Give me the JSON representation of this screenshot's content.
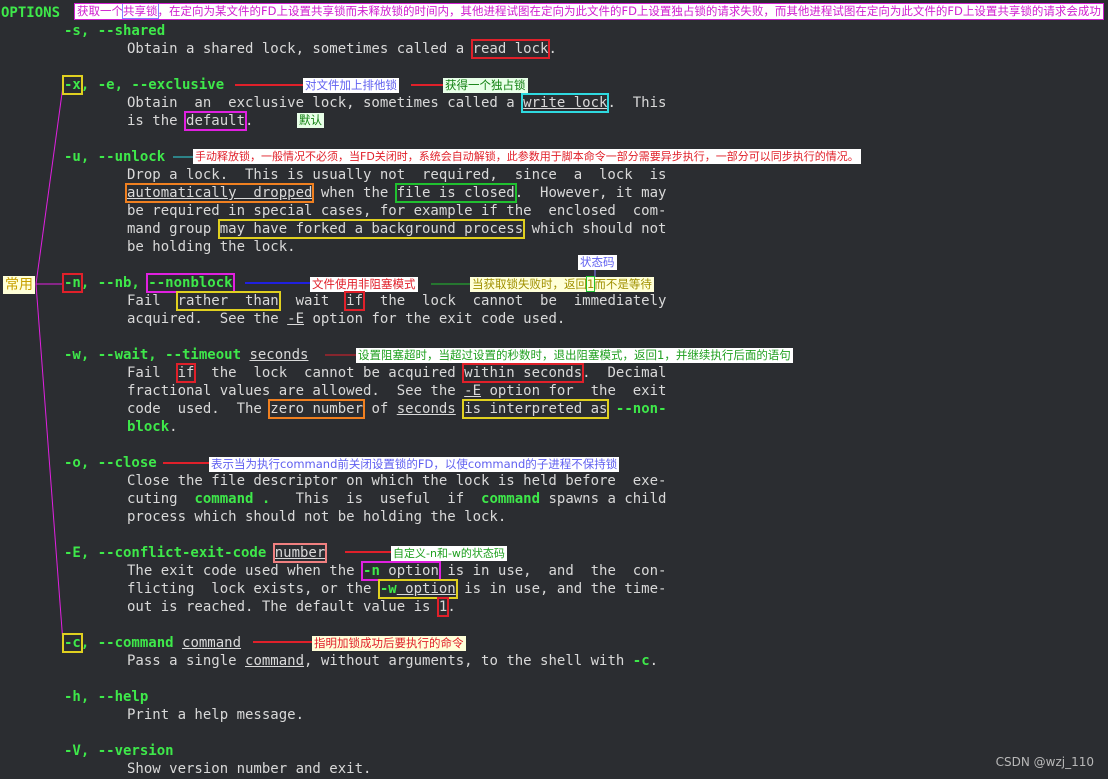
{
  "header": {
    "title": "OPTIONS",
    "note_pre": "获取一个",
    "note_box": "共享锁",
    "note_post": "，在定向为某文件的FD上设置共享锁而未释放锁的时间内，其他进程试图在定向为此文件的FD上设置独占锁的请求失败，而其他进程试图在定向为此文件的FD上设置共享锁的请求会成功"
  },
  "side_label": "常用",
  "s": {
    "flag": "-s, --shared",
    "d1a": "Obtain a shared lock, sometimes called a ",
    "d1b": "read lock",
    "d1c": "."
  },
  "x": {
    "f1": "-x",
    "f2": ", -e, --exclusive",
    "ann1": "对文件加上排他锁",
    "ann2": "获得一个独占锁",
    "d1a": "Obtain  an  exclusive lock, sometimes called a ",
    "d1b": "write lock",
    "d1c": ".  This",
    "d2a": "is the ",
    "d2b": "default",
    "d2c": ".",
    "ann3": "默认"
  },
  "u": {
    "flag": "-u, --unlock",
    "ann": "手动释放锁，一般情况不必须，当FD关闭时，系统会自动解锁，此参数用于脚本命令一部分需要异步执行，一部分可以同步执行的情况。",
    "d1": "Drop a lock.  This is usually not  required,  since  a  lock  is",
    "d2a": "automatically  dropped",
    "d2b": " when the ",
    "d2c": "file is closed",
    "d2d": ".  However, it may",
    "d3": "be required in special cases, for example if the  enclosed  com-",
    "d4a": "mand group ",
    "d4b": "may have forked a background process",
    "d4c": " which should not",
    "d5": "be holding the lock."
  },
  "n": {
    "f1": "-n",
    "f2": ", --nb, ",
    "f3": "--nonblock",
    "ann1": "文件使用非阻塞模式",
    "ann2a": "当获取锁失败时，返回",
    "ann2b": "1",
    "ann2c": "而不是等待",
    "ann_top": "状态码",
    "d1a": "Fail  ",
    "d1b": "rather  than",
    "d1c": "  wait  ",
    "d1d": "if",
    "d1e": "  the  lock  cannot  be  immediately",
    "d2a": "acquired.  See the ",
    "d2b": "-E",
    "d2c": " option for the exit code used."
  },
  "w": {
    "flag": "-w, --wait, --timeout ",
    "arg": "seconds",
    "ann": "设置阻塞超时，当超过设置的秒数时，退出阻塞模式，返回1，并继续执行后面的语句",
    "d1a": "Fail  ",
    "d1b": "if",
    "d1c": "  the  lock  cannot be acquired ",
    "d1d": "within seconds",
    ".": "",
    "d1e": ".  Decimal",
    "d2a": "fractional values are allowed.  See the ",
    "d2b": "-E",
    "d2c": " option for  the  exit",
    "d3a": "code  used.  The ",
    "d3b": "zero number",
    "d3c": " of ",
    "d3d": "seconds",
    "d3e": " ",
    "d3f": "is interpreted as",
    "d3g": " ",
    "d3h": "--non-",
    "d4": "block",
    "d4b": "."
  },
  "o": {
    "flag": "-o, --close",
    "ann": "表示当为执行command前关闭设置锁的FD，以使command的子进程不保持锁",
    "d1": "Close the file descriptor on which the lock is held before  exe-",
    "d2a": "cuting  ",
    "d2b": "command .",
    "d2c": "   This  is  useful  if  ",
    "d2d": "command",
    "d2e": " spawns a child",
    "d3": "process which should not be holding the lock."
  },
  "E": {
    "flag": "-E, --conflict-exit-code ",
    "arg": "number",
    "ann": "自定义-n和-w的状态码",
    "d1a": "The exit code used when the ",
    "d1b": "-n option",
    "d1c": " is in use,  and  the  con-",
    "d2a": "flicting  lock exists, or the ",
    "d2b": "-w option",
    "d2c": " is in use, and the time-",
    "d3a": "out is reached. The default value is ",
    "d3b": "1",
    "d3c": "."
  },
  "c": {
    "f1": "-c",
    "f2": ", --command ",
    "arg": "command",
    "ann": "指明加锁成功后要执行的命令",
    "d1a": "Pass a single ",
    "d1b": "command",
    "d1c": ", without arguments, to the shell with ",
    "d1d": "-c",
    "d1e": "."
  },
  "h": {
    "flag": "-h, --help",
    "d1": "Print a help message."
  },
  "V": {
    "flag": "-V, --version",
    "d1": "Show version number and exit."
  },
  "watermark": "CSDN @wzj_110",
  "colors": {
    "flag": "#3ee84a",
    "red": "#e0202a",
    "magenta": "#e020e0",
    "cyan": "#2fd9e0",
    "yellow": "#e0d020",
    "orange": "#f08020",
    "green": "#20c030",
    "salmon": "#f08080"
  }
}
